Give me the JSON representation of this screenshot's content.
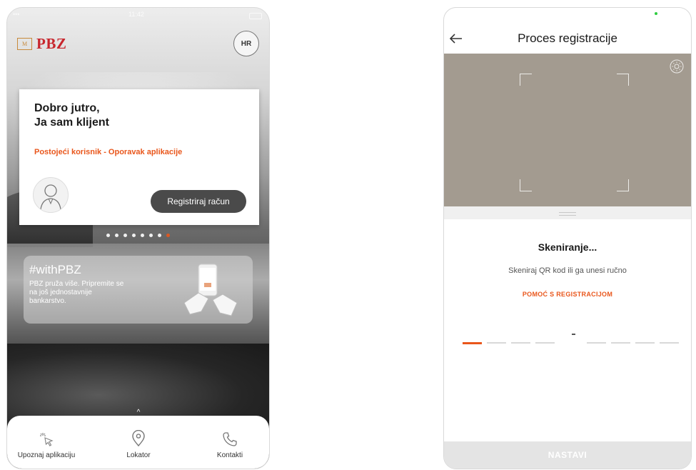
{
  "left_screen": {
    "status": {
      "time": "11:42"
    },
    "brand": {
      "logo_mark": "M",
      "name": "PBZ"
    },
    "language_button": "HR",
    "welcome": {
      "greeting_line1": "Dobro jutro,",
      "greeting_line2": "Ja sam klijent",
      "existing_user_link": "Postojeći korisnik - Oporavak aplikacije",
      "register_button": "Registriraj račun"
    },
    "carousel": {
      "dot_count": 8,
      "active_index": 7
    },
    "promo": {
      "hashtag": "#withPBZ",
      "text": "PBZ pruža više. Pripremite se na još jednostavnije bankarstvo."
    },
    "bottom_nav": [
      {
        "label": "Upoznaj aplikaciju",
        "icon": "sparkle-cursor-icon"
      },
      {
        "label": "Lokator",
        "icon": "location-pin-icon"
      },
      {
        "label": "Kontakti",
        "icon": "phone-icon"
      }
    ]
  },
  "right_screen": {
    "header_title": "Proces registracije",
    "scan_title": "Skeniranje...",
    "scan_subtitle": "Skeniraj QR kod ili ga unesi ručno",
    "help_link": "POMOĆ S REGISTRACIJOM",
    "code_slots": 8,
    "continue_button": "NASTAVI"
  },
  "colors": {
    "accent_orange": "#e9561b",
    "brand_red": "#c8262d",
    "button_dark": "#4a4a4a",
    "camera_bg": "#a39b90"
  }
}
